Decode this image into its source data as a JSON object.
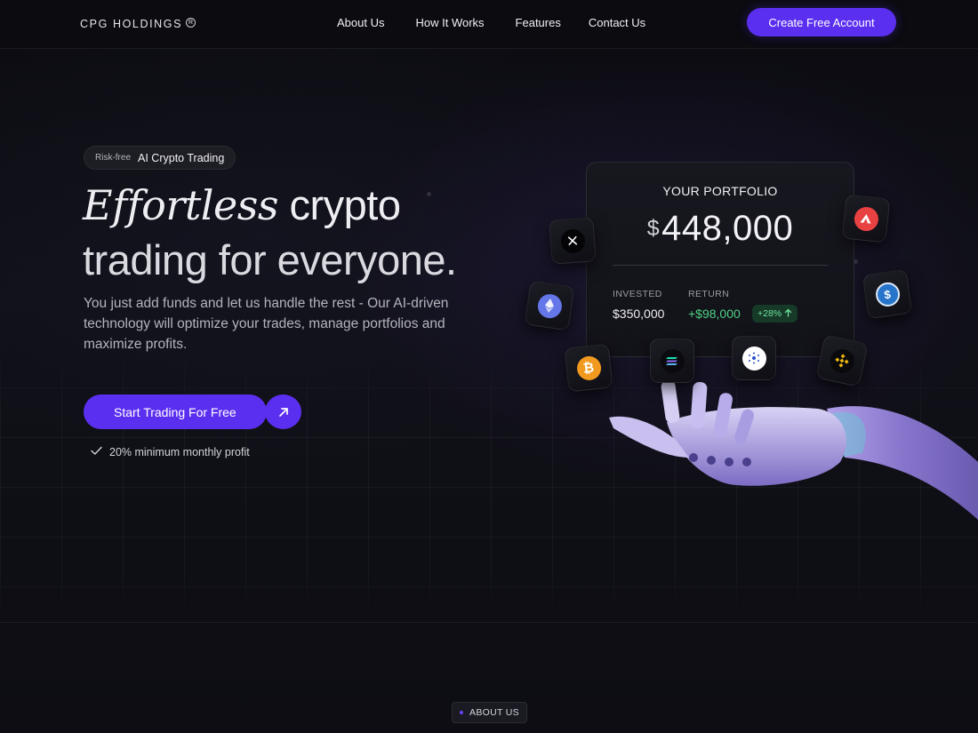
{
  "brand": {
    "name": "CPG HOLDINGS",
    "reg_mark": "R"
  },
  "nav": {
    "links": [
      "About Us",
      "How It Works",
      "Features",
      "Contact Us"
    ],
    "cta": "Create Free Account"
  },
  "hero": {
    "pill_small": "Risk-free",
    "pill_main": "AI Crypto Trading",
    "title_italic": "Effortless",
    "title_rest": " crypto",
    "title_line2": "trading for everyone.",
    "description": "You just add funds and let us handle the rest - Our AI-driven technology will optimize your trades, manage portfolios and maximize profits.",
    "cta": "Start Trading For Free",
    "cta_icon": "arrow-up-right-icon",
    "note": "20% minimum monthly profit",
    "note_icon": "check-icon"
  },
  "portfolio": {
    "title": "YOUR PORTFOLIO",
    "currency": "$",
    "amount": "448,000",
    "invested_label": "INVESTED",
    "invested_value": "$350,000",
    "return_label": "RETURN",
    "return_value": "+$98,000",
    "return_pct": "+28%",
    "accent_green": "#4ed184"
  },
  "coins": [
    "x-icon",
    "ethereum-icon",
    "bitcoin-icon",
    "solana-icon",
    "cardano-icon",
    "binance-icon",
    "avalanche-icon",
    "usdc-icon"
  ],
  "about_tag": "ABOUT US",
  "colors": {
    "accent": "#5b2ff0",
    "background": "#0c0c12"
  }
}
